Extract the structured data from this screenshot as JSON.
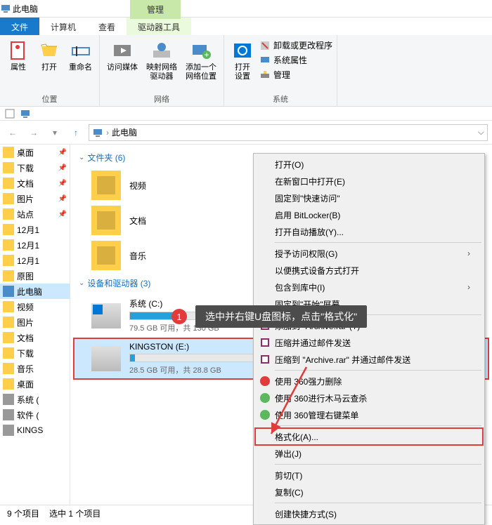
{
  "window": {
    "title": "此电脑",
    "manage_tab": "管理"
  },
  "tabs": {
    "file": "文件",
    "computer": "计算机",
    "view": "查看",
    "drive_tools": "驱动器工具"
  },
  "ribbon": {
    "group_position": "位置",
    "group_network": "网络",
    "group_system": "系统",
    "properties": "属性",
    "open": "打开",
    "rename": "重命名",
    "access_media": "访问媒体",
    "map_drive": "映射网络\n驱动器",
    "add_location": "添加一个\n网络位置",
    "open_settings": "打开\n设置",
    "uninstall": "卸载或更改程序",
    "sys_props": "系统属性",
    "manage": "管理"
  },
  "address": {
    "path": "此电脑"
  },
  "sidebar": {
    "items": [
      {
        "label": "桌面",
        "pinned": true,
        "type": "folder"
      },
      {
        "label": "下载",
        "pinned": true,
        "type": "folder"
      },
      {
        "label": "文档",
        "pinned": true,
        "type": "folder"
      },
      {
        "label": "图片",
        "pinned": true,
        "type": "folder"
      },
      {
        "label": "站点",
        "pinned": true,
        "type": "folder"
      },
      {
        "label": "12月1",
        "pinned": false,
        "type": "folder"
      },
      {
        "label": "12月1",
        "pinned": false,
        "type": "folder"
      },
      {
        "label": "12月1",
        "pinned": false,
        "type": "folder"
      },
      {
        "label": "原图",
        "pinned": false,
        "type": "folder"
      },
      {
        "label": "此电脑",
        "selected": true,
        "type": "pc"
      },
      {
        "label": "视频",
        "type": "folder"
      },
      {
        "label": "图片",
        "type": "folder"
      },
      {
        "label": "文档",
        "type": "folder"
      },
      {
        "label": "下载",
        "type": "folder"
      },
      {
        "label": "音乐",
        "type": "folder"
      },
      {
        "label": "桌面",
        "type": "folder"
      },
      {
        "label": "系统 (",
        "type": "drive"
      },
      {
        "label": "软件 (",
        "type": "drive"
      },
      {
        "label": "KINGS",
        "type": "drive"
      }
    ]
  },
  "content": {
    "folders_header": "文件夹 (6)",
    "devices_header": "设备和驱动器 (3)",
    "folders": [
      {
        "name": "视频"
      },
      {
        "name": "文档"
      },
      {
        "name": "音乐"
      }
    ],
    "drives": [
      {
        "name": "系统 (C:)",
        "sub": "79.5 GB 可用，共 130 GB",
        "fill_pct": 38,
        "win": true
      },
      {
        "name": "KINGSTON (E:)",
        "sub": "28.5 GB 可用，共 28.8 GB",
        "fill_pct": 4,
        "selected": true
      }
    ]
  },
  "context_menu": {
    "items": [
      {
        "label": "打开(O)"
      },
      {
        "label": "在新窗口中打开(E)"
      },
      {
        "label": "固定到\"快速访问\""
      },
      {
        "label": "启用 BitLocker(B)"
      },
      {
        "label": "打开自动播放(Y)..."
      },
      {
        "sep": true
      },
      {
        "label": "授予访问权限(G)",
        "arrow": true
      },
      {
        "label": "以便携式设备方式打开"
      },
      {
        "label": "包含到库中(I)",
        "arrow": true
      },
      {
        "label": "固定到\"开始\"屏幕"
      },
      {
        "sep": true
      },
      {
        "label": "添加到 \"Archive.rar\"(T)",
        "icon": "rar"
      },
      {
        "label": "压缩并通过邮件发送",
        "icon": "rar"
      },
      {
        "label": "压缩到 \"Archive.rar\" 并通过邮件发送",
        "icon": "rar"
      },
      {
        "sep": true
      },
      {
        "label": "使用 360强力删除",
        "icon": "360"
      },
      {
        "label": "使用 360进行木马云查杀",
        "icon": "360g"
      },
      {
        "label": "使用 360管理右键菜单",
        "icon": "360g"
      },
      {
        "sep": true
      },
      {
        "label": "格式化(A)...",
        "highlight": true
      },
      {
        "label": "弹出(J)"
      },
      {
        "sep": true
      },
      {
        "label": "剪切(T)"
      },
      {
        "label": "复制(C)"
      },
      {
        "sep": true
      },
      {
        "label": "创建快捷方式(S)"
      }
    ]
  },
  "annotation": {
    "badge": "1",
    "text": "选中并右键U盘图标，点击\"格式化\""
  },
  "status": {
    "items": "9 个项目",
    "selected": "选中 1 个项目"
  }
}
